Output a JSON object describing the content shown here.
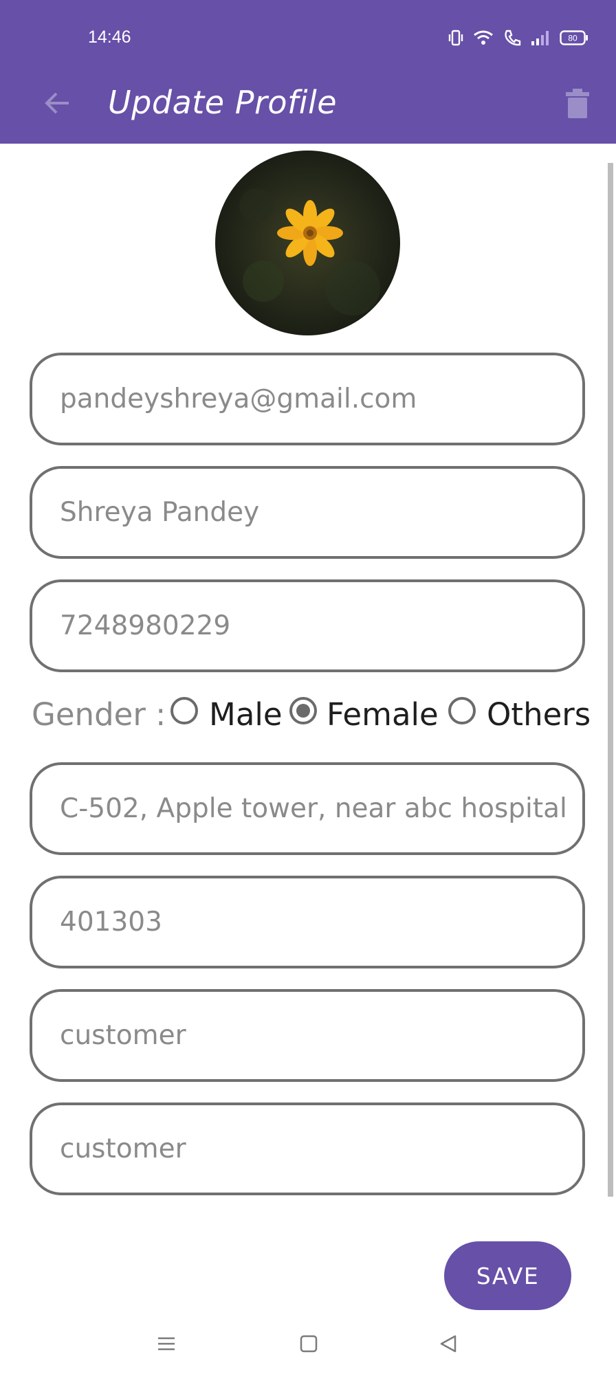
{
  "status_bar": {
    "time": "14:46",
    "battery": "80"
  },
  "app_bar": {
    "title": "Update Profile"
  },
  "form": {
    "email": "pandeyshreya@gmail.com",
    "name": "Shreya Pandey",
    "phone": "7248980229",
    "gender": {
      "label": "Gender :",
      "options": [
        "Male",
        "Female",
        "Others"
      ],
      "selected": "Female"
    },
    "address": "C-502, Apple tower, near abc hospital",
    "pincode": "401303",
    "field_7": "customer",
    "field_8": "customer"
  },
  "actions": {
    "save_label": "SAVE"
  },
  "colors": {
    "primary": "#6750A8",
    "border": "#707070",
    "flower": "#F4B41A"
  },
  "icons": [
    "back-arrow-icon",
    "trash-icon",
    "vibrate-icon",
    "wifi-icon",
    "call-icon",
    "signal-icon",
    "battery-icon",
    "menu-icon",
    "home-icon",
    "back-triangle-icon"
  ]
}
